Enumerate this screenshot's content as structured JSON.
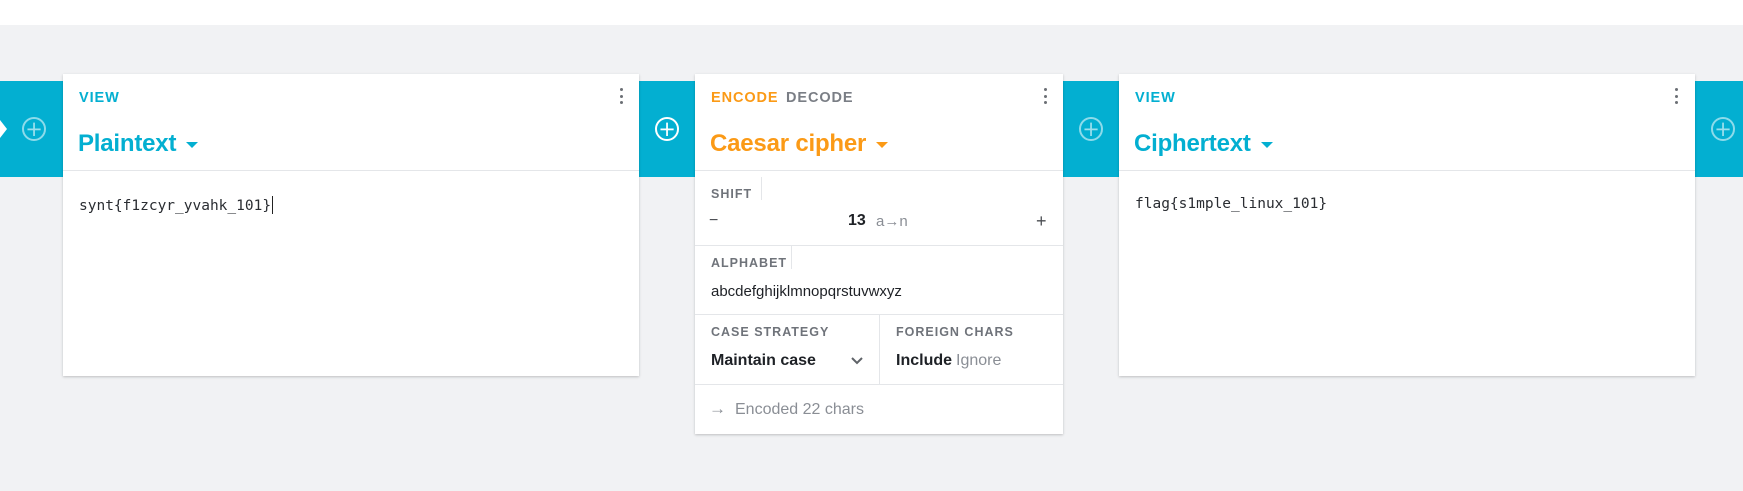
{
  "colors": {
    "accent_blue": "#03afd1",
    "accent_orange": "#fb9a16",
    "background": "#f1f2f4"
  },
  "plaintext_card": {
    "tab_view": "VIEW",
    "title": "Plaintext",
    "content": "synt{f1zcyr_yvahk_101}",
    "menu_icon": "more-vertical-icon"
  },
  "cipher_card": {
    "tab_encode": "ENCODE",
    "tab_decode": "DECODE",
    "title": "Caesar cipher",
    "shift": {
      "label": "SHIFT",
      "decrement": "−",
      "value": "13",
      "mapping": "a→n",
      "increment": "+"
    },
    "alphabet": {
      "label": "ALPHABET",
      "value": "abcdefghijklmnopqrstuvwxyz"
    },
    "case_strategy": {
      "label": "CASE STRATEGY",
      "value": "Maintain case"
    },
    "foreign_chars": {
      "label": "FOREIGN CHARS",
      "option_include": "Include",
      "option_ignore": "Ignore",
      "selected": "Include"
    },
    "status": {
      "arrow": "→",
      "text": "Encoded 22 chars"
    }
  },
  "ciphertext_card": {
    "tab_view": "VIEW",
    "title": "Ciphertext",
    "content": "flag{s1mple_linux_101}"
  },
  "connectors": {
    "add_icon": "plus-circle-icon"
  }
}
